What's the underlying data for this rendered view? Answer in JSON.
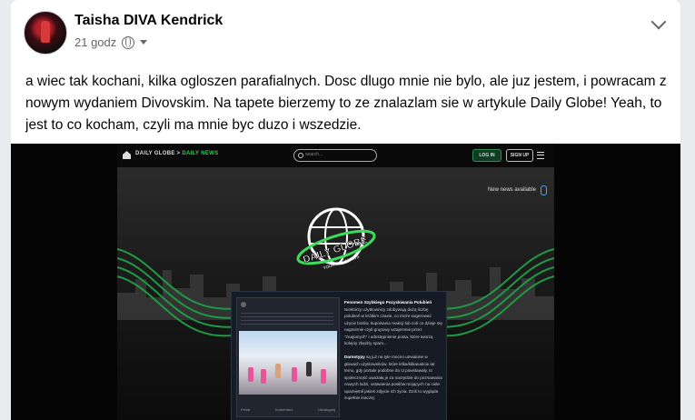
{
  "post": {
    "author": "Taisha DIVA Kendrick",
    "time": "21 godz",
    "text": "a wiec tak kochani, kilka ogloszen parafialnych. Dosc dlugo mnie nie bylo, ale juz jestem, i powracam z nowym wydaniem Divovskim. Na tapete bierzemy to ze znalazlam sie w artykule Daily Globe! Yeah, to jest to co kocham, czyli ma mnie byc duzo i wszedzie."
  },
  "screenshot": {
    "brand_main": "DAILY GLOBE",
    "brand_separator": " > ",
    "brand_section": "DAILY NEWS",
    "search_placeholder": "search...",
    "login_label": "LOG IN",
    "signup_label": "SIGN UP",
    "new_news_label": "New news available",
    "logo_title": "DAILY GLOBE",
    "logo_tagline": "YOUR DAILY NEWS",
    "article": {
      "heading": "Fenomen Szybkiego Pozyskiwania Polubień",
      "paragraph1": "Niektórzy użytkownicy zdobywają dużą liczbę polubień w krótkim czasie, co może sugerować użycie botów, kupowania reakcji lub coś co dzieje się nagminnie czyli grupowy wzajemnie przez \"znajomych\" i udostępnienie posta, które tworzą kolejny zbędny spam...",
      "heading2": "Darnotypy",
      "paragraph2": "są już na tyle mocno utrwalone w głowach użytkowników, które kilka/kilkanaście lat temu, gdy portale podobne do IJ powstawały, to społeczność uważała je za narzędzie do poznawania nowych ludzi, ustawienia posiłów mojących na ciele upamiętnił jakieś zdjęcie ich życia. Dziś to wygląda zupełnie inaczej.",
      "actions": [
        "Polub",
        "Komentarz",
        "Udostępnij"
      ]
    }
  },
  "colors": {
    "accent_green": "#34c759",
    "text_primary": "#050505",
    "text_secondary": "#65676b"
  }
}
